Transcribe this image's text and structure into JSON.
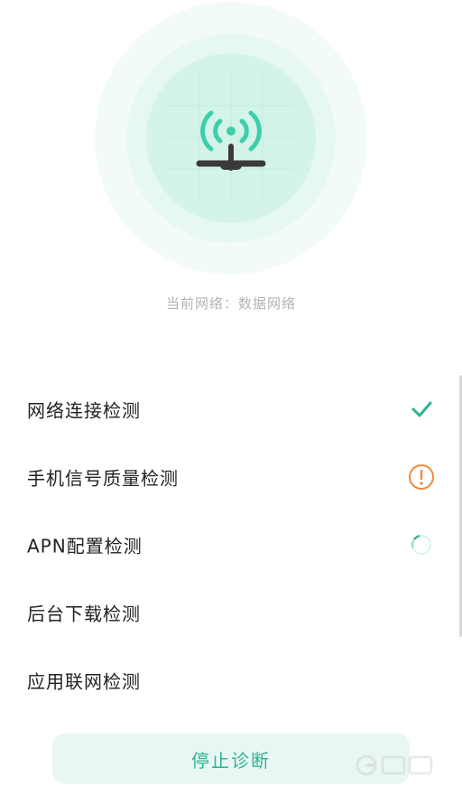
{
  "network_status": {
    "label": "当前网络",
    "separator": "：",
    "value": "数据网络"
  },
  "checks": [
    {
      "label": "网络连接检测",
      "status": "passed",
      "icon": "check-icon"
    },
    {
      "label": "手机信号质量检测",
      "status": "warning",
      "icon": "warning-icon"
    },
    {
      "label": "APN配置检测",
      "status": "in-progress",
      "icon": "loading-spinner-icon"
    },
    {
      "label": "后台下载检测",
      "status": "pending",
      "icon": ""
    },
    {
      "label": "应用联网检测",
      "status": "pending",
      "icon": ""
    }
  ],
  "stop_button_label": "停止诊断",
  "colors": {
    "accent": "#2fb393",
    "warning": "#f08a3c",
    "button_bg": "#e9f7f3",
    "ring_light": "#f2fbf8",
    "ring_inner": "#d4f4e9",
    "icon_dark": "#3a3a3a"
  }
}
